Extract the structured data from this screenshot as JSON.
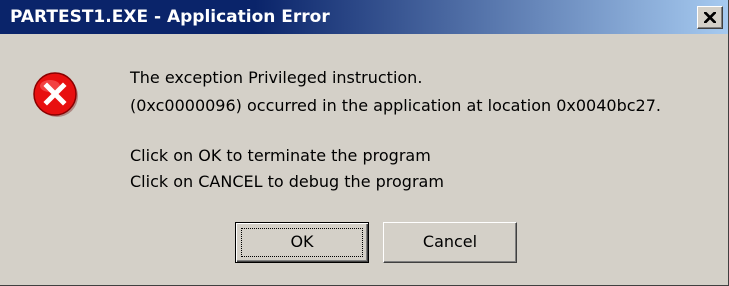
{
  "window": {
    "title": "PARTEST1.EXE - Application Error"
  },
  "icons": {
    "error": "error-icon",
    "close": "close-icon"
  },
  "message": {
    "line1": "The exception Privileged instruction.",
    "line2": " (0xc0000096) occurred in the application at location 0x0040bc27.",
    "line3": "Click on OK to terminate the program",
    "line4": "Click on CANCEL to debug the program"
  },
  "buttons": {
    "ok_label": "OK",
    "cancel_label": "Cancel"
  },
  "colors": {
    "title_start": "#0a246a",
    "title_end": "#a6caf0",
    "face": "#d4d0c8",
    "error_red": "#e81010"
  }
}
